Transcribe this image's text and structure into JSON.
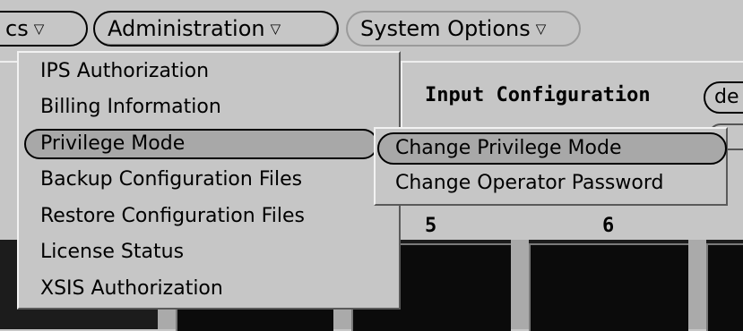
{
  "menubar": {
    "tools_label": "cs",
    "admin_label": "Administration",
    "sysopt_label": "System Options",
    "arrow": "▽"
  },
  "panel": {
    "heading": "Input Configuration",
    "mini_button_label": "de",
    "column_numbers": [
      "5",
      "6"
    ]
  },
  "admin_menu": {
    "items": [
      {
        "label": "IPS Authorization"
      },
      {
        "label": "Billing Information"
      },
      {
        "label": "Privilege Mode",
        "selected": true,
        "submenu_indicator": "r"
      },
      {
        "label": "Backup Configuration Files"
      },
      {
        "label": "Restore Configuration Files"
      },
      {
        "label": "License Status"
      },
      {
        "label": "XSIS Authorization"
      }
    ]
  },
  "privilege_submenu": {
    "items": [
      {
        "label": "Change Privilege Mode",
        "selected": true
      },
      {
        "label": "Change Operator Password"
      }
    ]
  }
}
